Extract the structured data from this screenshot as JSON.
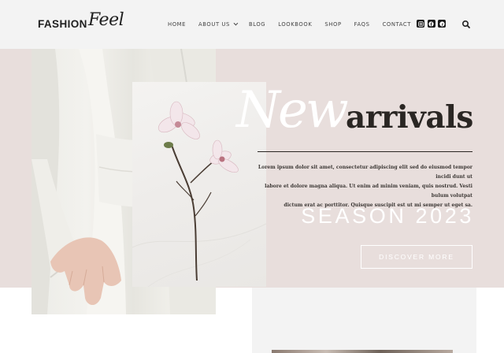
{
  "logo": {
    "bold": "FASHION",
    "script": "Feel"
  },
  "nav": {
    "items": [
      "HOME",
      "ABOUT US",
      "BLOG",
      "LOOKBOOK",
      "SHOP",
      "FAQS",
      "CONTACT"
    ]
  },
  "socials": [
    "instagram-icon",
    "facebook-icon",
    "pinterest-icon"
  ],
  "hero": {
    "script_word": "New",
    "title_word": "arrivals",
    "description_lines": [
      "Lorem ipsum dolor sit amet, consectetur adipiscing elit sed do eiusmod tempor incidi dunt ut",
      "labore et dolore magna aliqua. Ut enim ad minim veniam, quis nostrud. Vesti bulum volutpat",
      "dictum erat ac porttitor. Quisque suscipit est ut mi semper ut eget sa."
    ],
    "season": "SEASON 2023",
    "cta": "DISCOVER MORE"
  },
  "colors": {
    "header_bg": "#f3f3f3",
    "hero_bg": "#e8dedc",
    "text_dark": "#2a2623"
  }
}
